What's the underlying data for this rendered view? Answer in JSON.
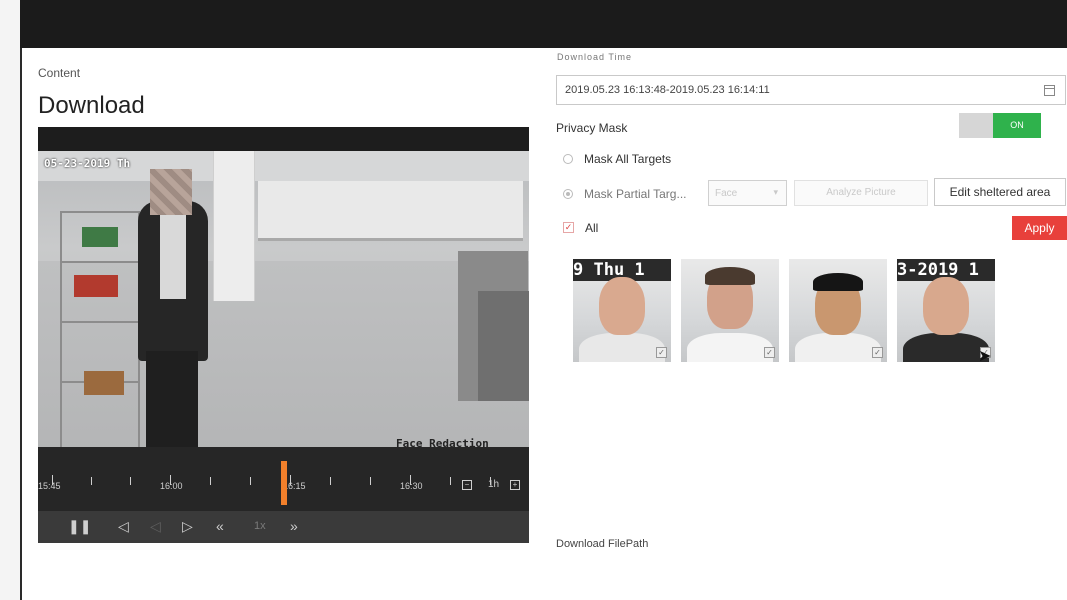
{
  "content_label": "Content",
  "page_title": "Download",
  "video": {
    "osd_datetime": "05-23-2019 Th",
    "osd_redaction": "Face Redaction",
    "timeline_labels": [
      "15:45",
      "16:00",
      "16:15",
      "16:30"
    ],
    "zoom_label": "1h",
    "zoom_minus": "−",
    "zoom_plus": "+",
    "speed_label": "1x"
  },
  "controls": {
    "pause_icon": "❚❚",
    "prev_frame_icon": "◁",
    "step_back_icon": "◁",
    "next_frame_icon": "▷",
    "slow_icon": "«",
    "fast_icon": "»"
  },
  "right_panel": {
    "time_range_label": "Download Time",
    "time_range_value": "2019.05.23 16:13:48-2019.05.23 16:14:11",
    "privacy_mask_label": "Privacy Mask",
    "privacy_mask_state": "ON",
    "mask_all_label": "Mask All  Targets",
    "mask_partial_label": "Mask Partial  Targ...",
    "target_type_value": "Face",
    "analyze_picture_label": "Analyze Picture",
    "edit_area_label": "Edit sheltered area",
    "all_label": "All",
    "apply_label": "Apply",
    "download_path_label": "Download FilePath",
    "thumbnails": [
      {
        "header": "9 Thu 1"
      },
      {
        "header": ""
      },
      {
        "header": ""
      },
      {
        "header": "3-2019 1"
      }
    ]
  },
  "colors": {
    "accent_on": "#2fb24c",
    "apply": "#e8403b",
    "playhead": "#f2802b"
  }
}
